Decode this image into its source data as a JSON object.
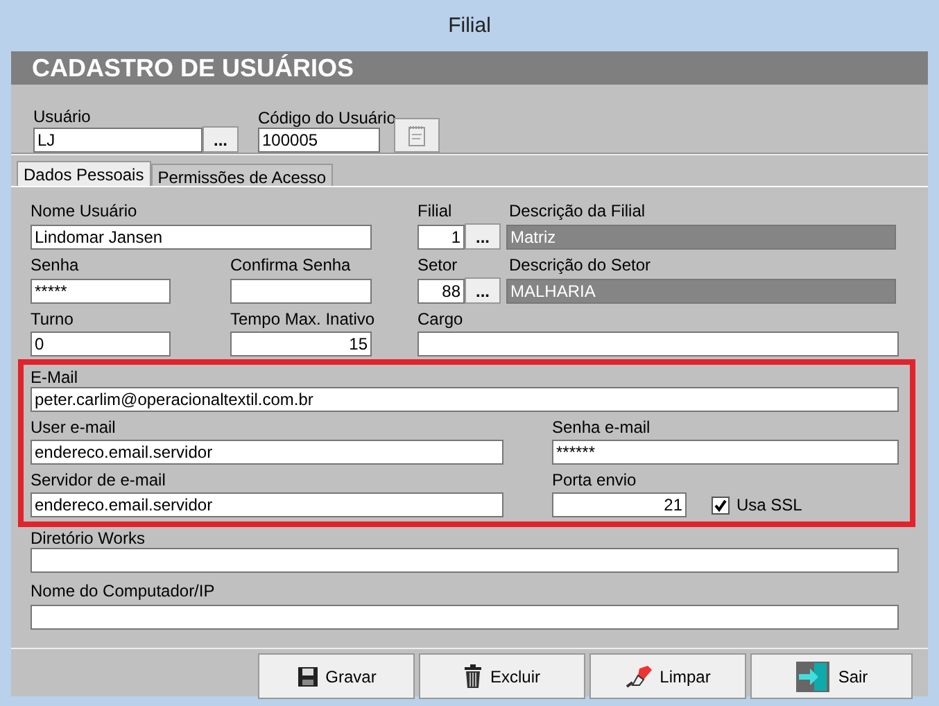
{
  "window": {
    "title": "Filial"
  },
  "header": {
    "title": "CADASTRO DE USUÁRIOS"
  },
  "user": {
    "label": "Usuário",
    "value": "LJ",
    "lookup_button": "..."
  },
  "user_code": {
    "label": "Código do Usuário",
    "value": "100005"
  },
  "tabs": [
    {
      "label": "Dados Pessoais",
      "selected": true
    },
    {
      "label": "Permissões de Acesso",
      "selected": false
    }
  ],
  "form": {
    "name": {
      "label": "Nome Usuário",
      "value": "Lindomar Jansen"
    },
    "branch": {
      "label": "Filial",
      "value": "1",
      "lookup_button": "..."
    },
    "branch_description": {
      "label": "Descrição da Filial",
      "value": "Matriz"
    },
    "password": {
      "label": "Senha",
      "value": "*****"
    },
    "confirm_password": {
      "label": "Confirma Senha"
    },
    "sector": {
      "label": "Setor",
      "value": "88",
      "lookup_button": "..."
    },
    "sector_description": {
      "label": "Descrição do Setor",
      "value": "MALHARIA"
    },
    "shift": {
      "label": "Turno",
      "value": "0"
    },
    "max_idle_time": {
      "label": "Tempo Max. Inativo",
      "value": "15"
    },
    "role": {
      "label": "Cargo"
    },
    "email": {
      "label": "E-Mail",
      "value": "peter.carlim@operacionaltextil.com.br"
    },
    "email_user": {
      "label": "User e-mail",
      "value": "endereco.email.servidor"
    },
    "email_password": {
      "label": "Senha e-mail",
      "value": "******"
    },
    "email_server": {
      "label": "Servidor de e-mail",
      "value": "endereco.email.servidor"
    },
    "send_port": {
      "label": "Porta envio",
      "value": "21"
    },
    "use_ssl": {
      "label": "Usa SSL",
      "checked": true
    },
    "works_directory": {
      "label": "Diretório Works"
    },
    "computer_name": {
      "label": "Nome do Computador/IP"
    }
  },
  "buttons": [
    {
      "label": "Gravar",
      "kind": "save"
    },
    {
      "label": "Excluir",
      "kind": "delete"
    },
    {
      "label": "Limpar",
      "kind": "clear"
    },
    {
      "label": "Sair",
      "kind": "exit"
    }
  ]
}
